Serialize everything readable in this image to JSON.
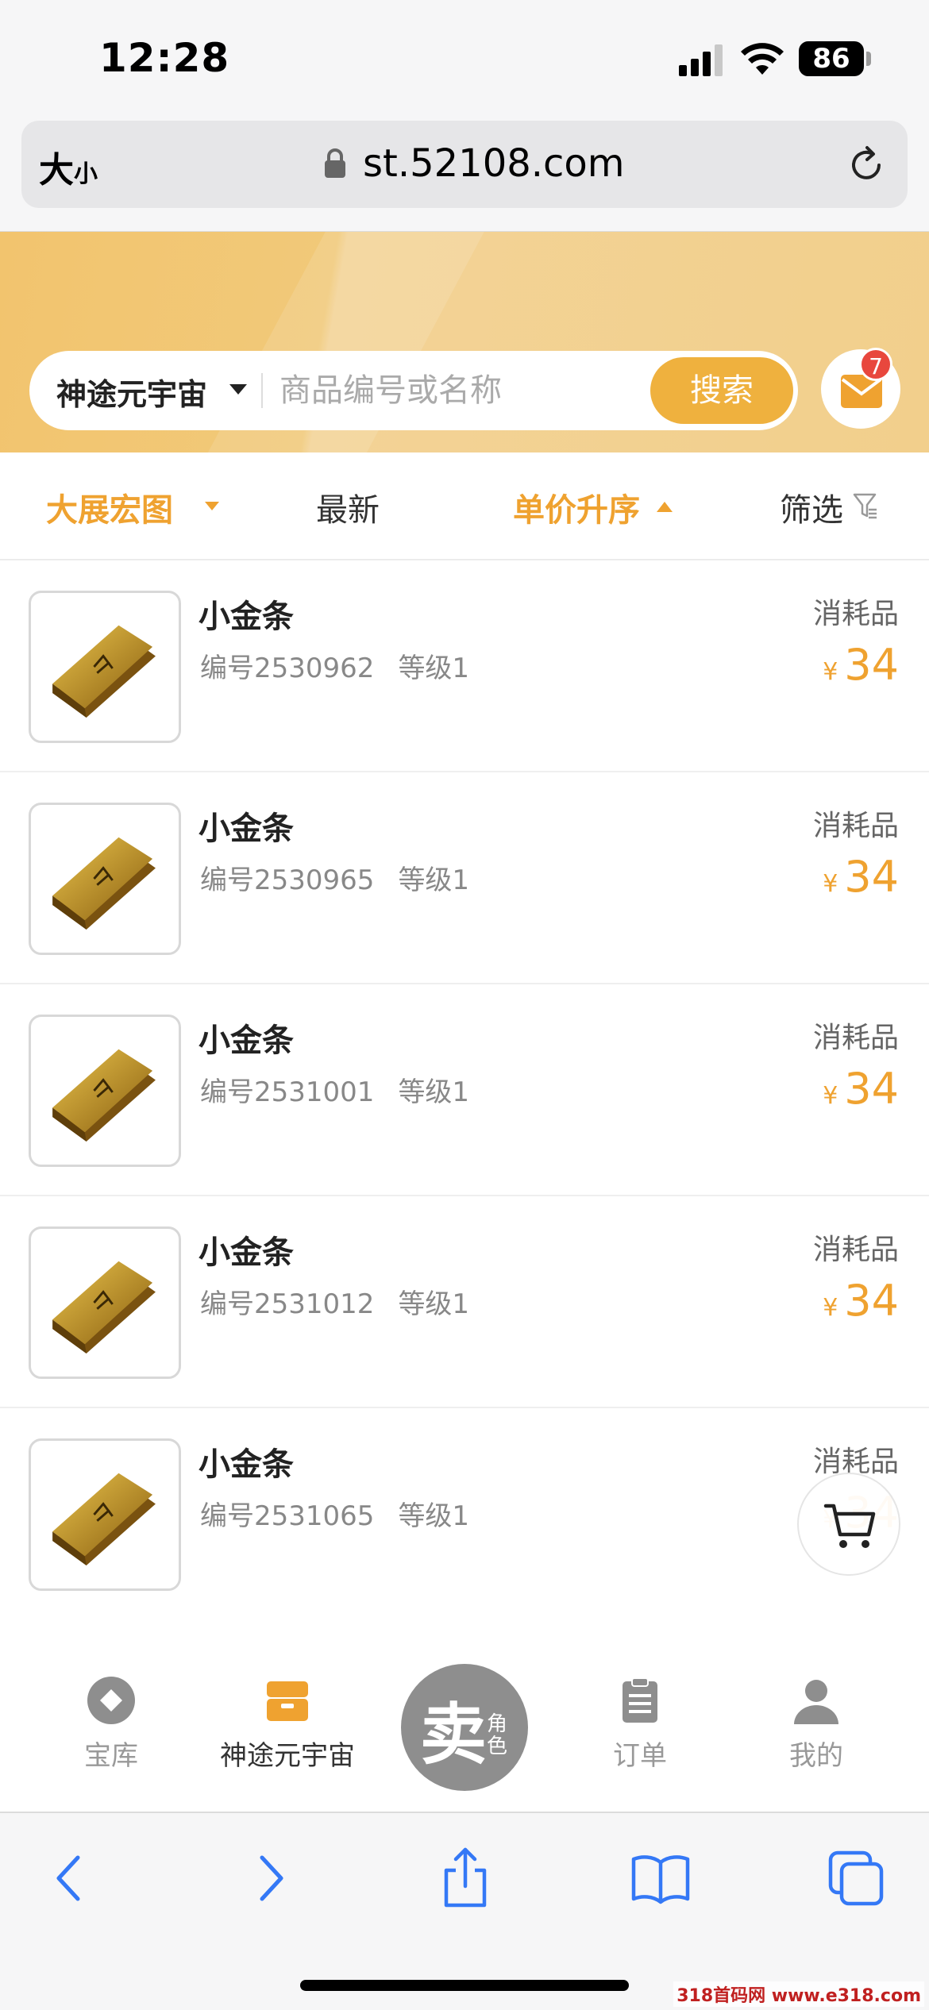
{
  "status_bar": {
    "time": "12:28",
    "battery": "86"
  },
  "browser": {
    "text_size_label_big": "大",
    "text_size_label_small": "小",
    "url": "st.52108.com"
  },
  "search": {
    "game_name": "神途元宇宙",
    "placeholder": "商品编号或名称",
    "button_label": "搜索",
    "message_count": "7"
  },
  "filters": {
    "server": "大展宏图",
    "newest": "最新",
    "price_sort": "单价升序",
    "filter": "筛选"
  },
  "products": [
    {
      "name": "小金条",
      "id": "编号2530962",
      "level": "等级1",
      "type": "消耗品",
      "currency": "¥",
      "price": "34"
    },
    {
      "name": "小金条",
      "id": "编号2530965",
      "level": "等级1",
      "type": "消耗品",
      "currency": "¥",
      "price": "34"
    },
    {
      "name": "小金条",
      "id": "编号2531001",
      "level": "等级1",
      "type": "消耗品",
      "currency": "¥",
      "price": "34"
    },
    {
      "name": "小金条",
      "id": "编号2531012",
      "level": "等级1",
      "type": "消耗品",
      "currency": "¥",
      "price": "34"
    },
    {
      "name": "小金条",
      "id": "编号2531065",
      "level": "等级1",
      "type": "消耗品",
      "currency": "¥",
      "price": "34"
    }
  ],
  "nav": {
    "vault": "宝库",
    "game": "神途元宇宙",
    "sell_main": "卖",
    "sell_sub": "角色",
    "orders": "订单",
    "mine": "我的"
  },
  "colors": {
    "accent": "#efa230",
    "banner": "#f2c46e",
    "badge": "#e8473d",
    "safari_blue": "#3478f6"
  },
  "watermark": "318首码网 www.e318.com"
}
